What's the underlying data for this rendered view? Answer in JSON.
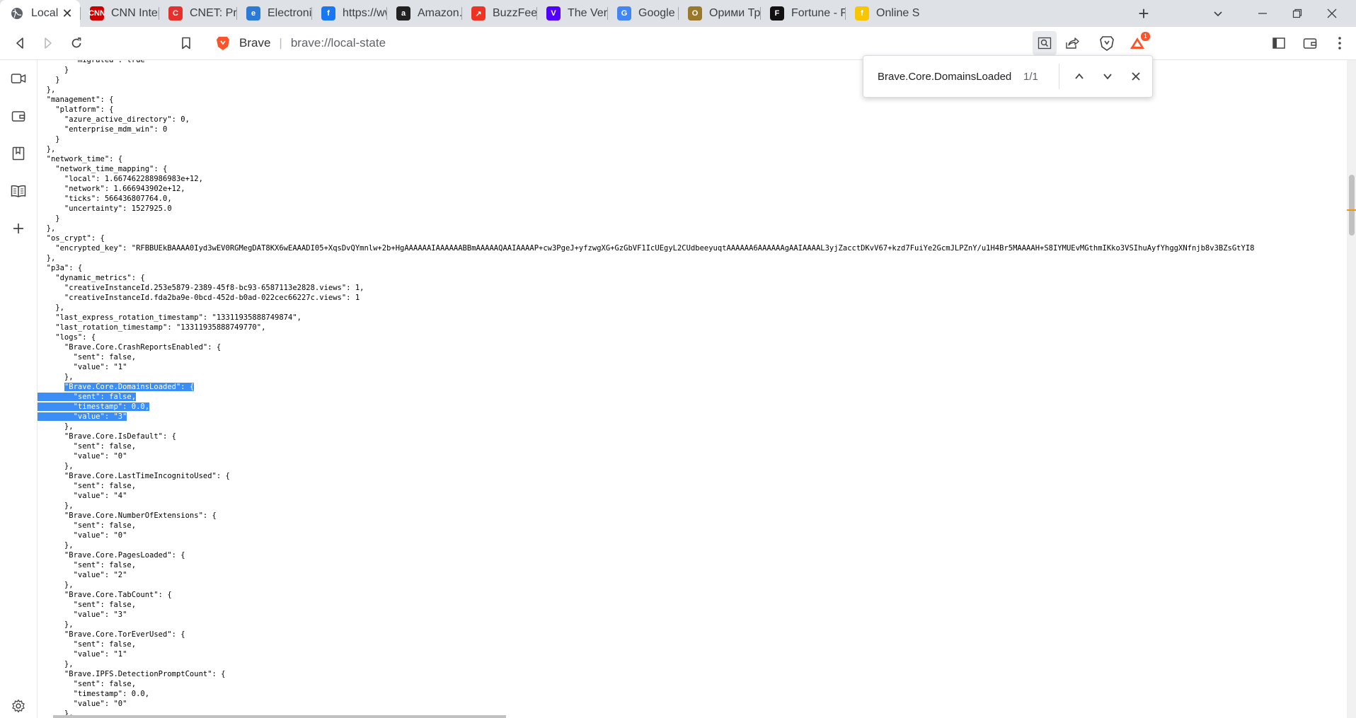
{
  "tabs": [
    {
      "title": "Local State",
      "icon": "globe-icon",
      "color": "#5f6368",
      "glyph": ""
    },
    {
      "title": "CNN International",
      "icon": "cnn-icon",
      "color": "#cc0000",
      "glyph": "CNN"
    },
    {
      "title": "CNET: Product reviews",
      "icon": "cnet-icon",
      "color": "#e6302b",
      "glyph": "C"
    },
    {
      "title": "Electronics, Cars",
      "icon": "ebay-bag-icon",
      "color": "#2a7ad6",
      "glyph": "e"
    },
    {
      "title": "https://www.facebook.com",
      "icon": "facebook-icon",
      "color": "#1877f2",
      "glyph": "f"
    },
    {
      "title": "Amazon.com",
      "icon": "amazon-icon",
      "color": "#222222",
      "glyph": "a"
    },
    {
      "title": "BuzzFeed",
      "icon": "buzzfeed-icon",
      "color": "#ee3322",
      "glyph": "↗"
    },
    {
      "title": "The Verge",
      "icon": "verge-icon",
      "color": "#5100ff",
      "glyph": "V"
    },
    {
      "title": "Google",
      "icon": "google-icon",
      "color": "#4285f4",
      "glyph": "G"
    },
    {
      "title": "Орими Трэйд",
      "icon": "orimi-icon",
      "color": "#9a7a2a",
      "glyph": "O"
    },
    {
      "title": "Fortune - Fortune",
      "icon": "fortune-icon",
      "color": "#111111",
      "glyph": "F"
    },
    {
      "title": "Online Shopping",
      "icon": "flipkart-icon",
      "color": "#f7c600",
      "glyph": "f"
    }
  ],
  "omnibox": {
    "brand": "Brave",
    "separator": "|",
    "url": "brave://local-state"
  },
  "find": {
    "query": "Brave.Core.DomainsLoaded",
    "count": "1/1"
  },
  "notification_badge": "1",
  "code_lines": [
    "        \"migrated\": true",
    "      }",
    "    }",
    "  },",
    "  \"management\": {",
    "    \"platform\": {",
    "      \"azure_active_directory\": 0,",
    "      \"enterprise_mdm_win\": 0",
    "    }",
    "  },",
    "  \"network_time\": {",
    "    \"network_time_mapping\": {",
    "      \"local\": 1.667462288986983e+12,",
    "      \"network\": 1.666943902e+12,",
    "      \"ticks\": 566436807764.0,",
    "      \"uncertainty\": 1527925.0",
    "    }",
    "  },",
    "  \"os_crypt\": {",
    "    \"encrypted_key\": \"RFBBUEkBAAAA0Iyd3wEV0RGMegDAT8KX6wEAAADI05+XqsDvQYmnlw+2b+HgAAAAAAIAAAAAABBmAAAAAQAAIAAAAP+cw3PgeJ+yfzwgXG+GzGbVF1IcUEgyL2CUdbeeyuqtAAAAAA6AAAAAAgAAIAAAAL3yjZacctDKvV67+kzd7FuiYe2GcmJLPZnY/u1H4Br5MAAAAH+S8IYMUEvMGthmIKko3VSIhuAyfYhggXNfnjb8v3BZsGtYI8",
    "  },",
    "  \"p3a\": {",
    "    \"dynamic_metrics\": {",
    "      \"creativeInstanceId.253e5879-2389-45f8-bc93-6587113e2828.views\": 1,",
    "      \"creativeInstanceId.fda2ba9e-0bcd-452d-b0ad-022cec66227c.views\": 1",
    "    },",
    "    \"last_express_rotation_timestamp\": \"13311935888749874\",",
    "    \"last_rotation_timestamp\": \"13311935888749770\",",
    "    \"logs\": {",
    "      \"Brave.Core.CrashReportsEnabled\": {",
    "        \"sent\": false,",
    "        \"value\": \"1\"",
    "      },",
    "      \"Brave.Core.DomainsLoaded\": {",
    "        \"sent\": false,",
    "        \"timestamp\": 0.0,",
    "        \"value\": \"3\"",
    "      },",
    "      \"Brave.Core.IsDefault\": {",
    "        \"sent\": false,",
    "        \"value\": \"0\"",
    "      },",
    "      \"Brave.Core.LastTimeIncognitoUsed\": {",
    "        \"sent\": false,",
    "        \"value\": \"4\"",
    "      },",
    "      \"Brave.Core.NumberOfExtensions\": {",
    "        \"sent\": false,",
    "        \"value\": \"0\"",
    "      },",
    "      \"Brave.Core.PagesLoaded\": {",
    "        \"sent\": false,",
    "        \"value\": \"2\"",
    "      },",
    "      \"Brave.Core.TabCount\": {",
    "        \"sent\": false,",
    "        \"value\": \"3\"",
    "      },",
    "      \"Brave.Core.TorEverUsed\": {",
    "        \"sent\": false,",
    "        \"value\": \"1\"",
    "      },",
    "      \"Brave.IPFS.DetectionPromptCount\": {",
    "        \"sent\": false,",
    "        \"timestamp\": 0.0,",
    "        \"value\": \"0\"",
    "      },"
  ],
  "highlight": {
    "first_line": 33,
    "last_line": 36
  }
}
